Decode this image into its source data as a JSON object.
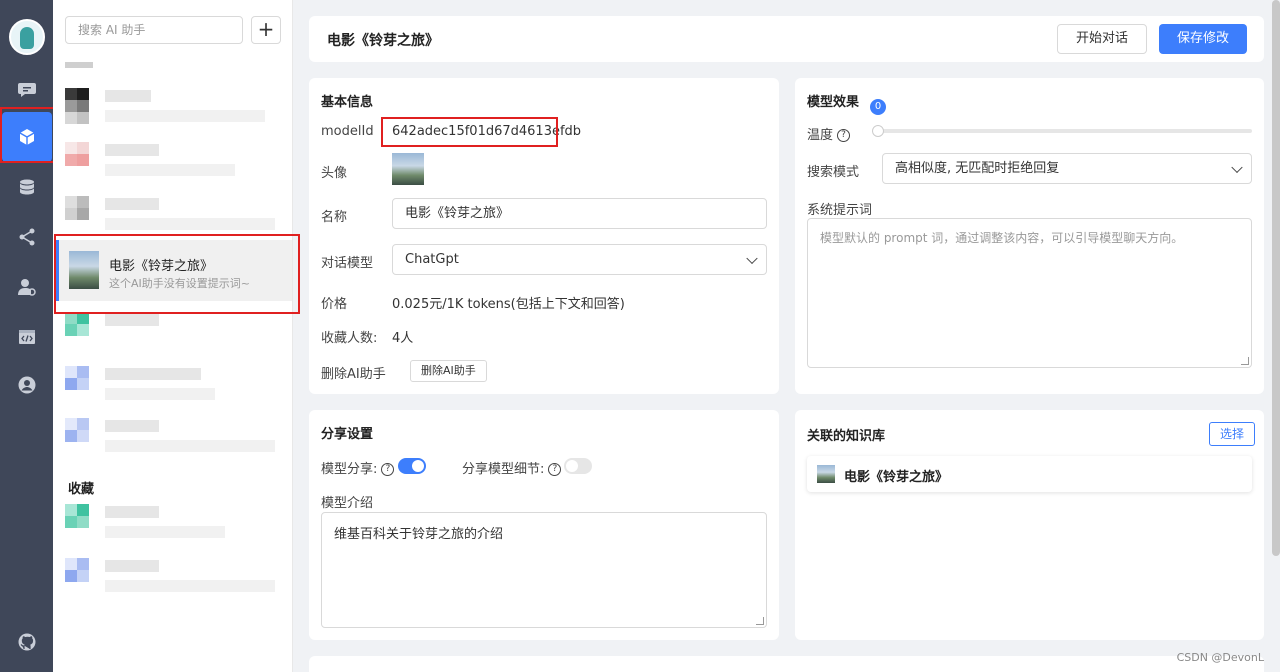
{
  "sidebar": {
    "logo_icon": "robot-avatar-icon",
    "nav": [
      {
        "icon": "chat-icon",
        "active": false
      },
      {
        "icon": "cube-icon",
        "active": true
      },
      {
        "icon": "database-icon",
        "active": false
      },
      {
        "icon": "share-icon",
        "active": false
      },
      {
        "icon": "user-settings-icon",
        "active": false
      },
      {
        "icon": "code-icon",
        "active": false
      },
      {
        "icon": "account-icon",
        "active": false
      }
    ],
    "bottom_icon": "github-icon",
    "accent": "#3d7efc"
  },
  "assistant_list": {
    "search_placeholder": "搜索 AI 助手",
    "add_label": "+",
    "selected": {
      "title": "电影《铃芽之旅》",
      "subtitle": "这个AI助手没有设置提示词~"
    },
    "favorites_label": "收藏"
  },
  "header": {
    "title": "电影《铃芽之旅》",
    "start_chat": "开始对话",
    "save": "保存修改"
  },
  "basic_info": {
    "title": "基本信息",
    "model_id_label": "modelId",
    "model_id": "642adec15f01d67d4613efdb",
    "avatar_label": "头像",
    "name_label": "名称",
    "name_value": "电影《铃芽之旅》",
    "chat_model_label": "对话模型",
    "chat_model_value": "ChatGpt",
    "price_label": "价格",
    "price_value": "0.025元/1K tokens(包括上下文和回答)",
    "favorites_label": "收藏人数:",
    "favorites_value": "4人",
    "delete_label": "删除AI助手",
    "delete_btn": "删除AI助手"
  },
  "model_effect": {
    "title": "模型效果",
    "temperature_label": "温度",
    "temperature_value": "0",
    "search_mode_label": "搜索模式",
    "search_mode_value": "高相似度, 无匹配时拒绝回复",
    "system_prompt_label": "系统提示词",
    "system_prompt_placeholder": "模型默认的 prompt 词，通过调整该内容，可以引导模型聊天方向。"
  },
  "share": {
    "title": "分享设置",
    "model_share_label": "模型分享:",
    "model_share_on": true,
    "share_detail_label": "分享模型细节:",
    "share_detail_on": false,
    "intro_label": "模型介绍",
    "intro_value": "维基百科关于铃芽之旅的介绍"
  },
  "knowledge": {
    "title": "关联的知识库",
    "select_btn": "选择",
    "items": [
      {
        "title": "电影《铃芽之旅》"
      }
    ]
  },
  "watermark": "CSDN @DevonL"
}
